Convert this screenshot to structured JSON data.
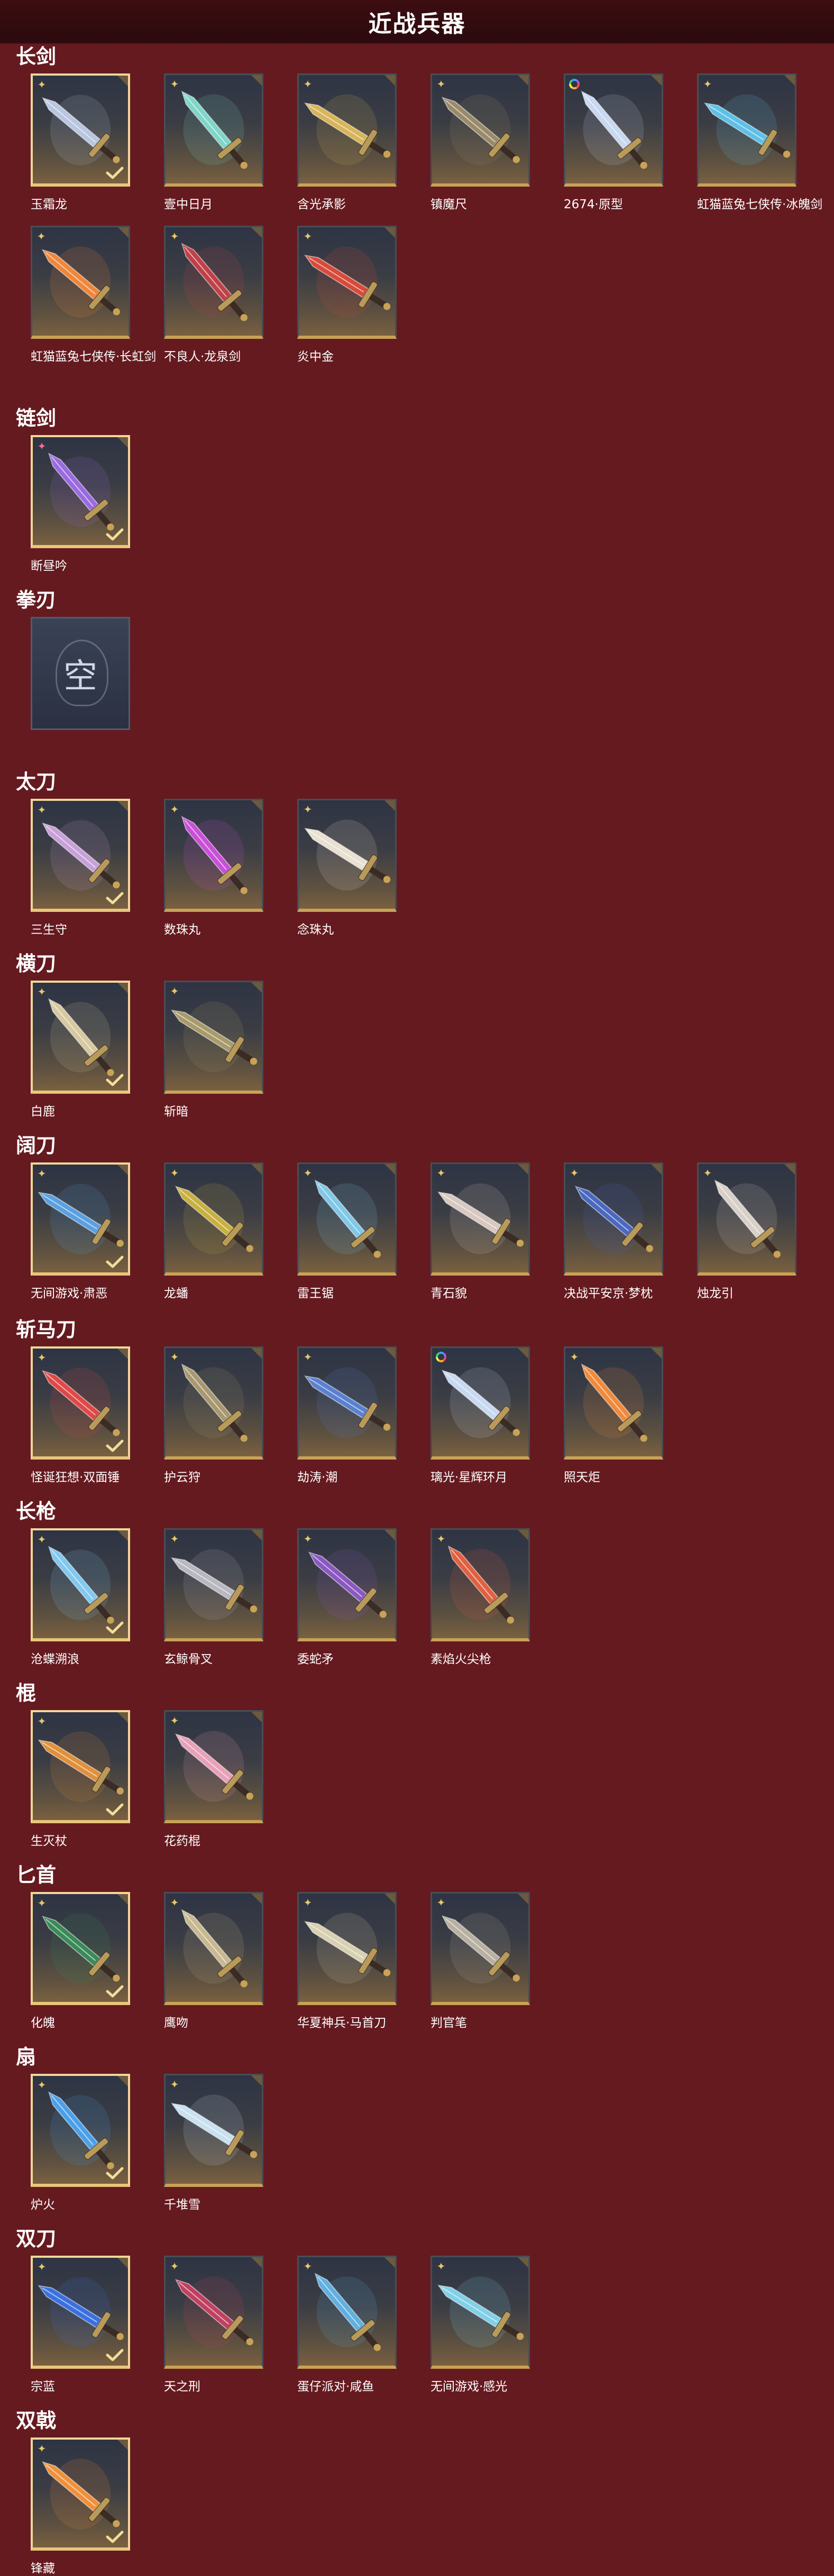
{
  "header": {
    "title": "近战兵器"
  },
  "categories": [
    {
      "name": "长剑",
      "items": [
        {
          "label": "玉霜龙",
          "selected": true,
          "rarity": "star",
          "color": "#b8c6e0"
        },
        {
          "label": "壹中日月",
          "selected": false,
          "rarity": "star",
          "color": "#7fd6c8"
        },
        {
          "label": "含光承影",
          "selected": false,
          "rarity": "star",
          "color": "#d8b45a"
        },
        {
          "label": "镇魔尺",
          "selected": false,
          "rarity": "star",
          "color": "#9a8a6a"
        },
        {
          "label": "2674·原型",
          "selected": false,
          "rarity": "rainbow",
          "color": "#c8d8f0"
        },
        {
          "label": "虹猫蓝兔七侠传·冰魄剑",
          "selected": false,
          "rarity": "star",
          "color": "#5ec0e8"
        },
        {
          "label": "虹猫蓝兔七侠传·长虹剑",
          "selected": false,
          "rarity": "star",
          "color": "#f0863a"
        },
        {
          "label": "不良人·龙泉剑",
          "selected": false,
          "rarity": "star",
          "color": "#c04048"
        },
        {
          "label": "炎中金",
          "selected": false,
          "rarity": "star",
          "color": "#d84a3a"
        }
      ]
    },
    {
      "name": "链剑",
      "items": [
        {
          "label": "断昼吟",
          "selected": true,
          "rarity": "pink",
          "color": "#9a6ae0"
        }
      ]
    },
    {
      "name": "拳刃",
      "items": [
        {
          "label": "",
          "selected": false,
          "rarity": "none",
          "empty": true,
          "empty_text": "空"
        }
      ]
    },
    {
      "name": "太刀",
      "items": [
        {
          "label": "三生守",
          "selected": true,
          "rarity": "star",
          "color": "#c8a0d8"
        },
        {
          "label": "数珠丸",
          "selected": false,
          "rarity": "star",
          "color": "#c850d8"
        },
        {
          "label": "念珠丸",
          "selected": false,
          "rarity": "star",
          "color": "#e8e0d0"
        }
      ]
    },
    {
      "name": "横刀",
      "items": [
        {
          "label": "白鹿",
          "selected": true,
          "rarity": "star",
          "color": "#d8c8a0"
        },
        {
          "label": "斩暗",
          "selected": false,
          "rarity": "star",
          "color": "#a89a6a"
        }
      ]
    },
    {
      "name": "阔刀",
      "items": [
        {
          "label": "无间游戏·肃恶",
          "selected": true,
          "rarity": "star",
          "color": "#5aa0e0"
        },
        {
          "label": "龙蟠",
          "selected": false,
          "rarity": "star",
          "color": "#c8b040"
        },
        {
          "label": "雷王锯",
          "selected": false,
          "rarity": "star",
          "color": "#80c8e8"
        },
        {
          "label": "青石貌",
          "selected": false,
          "rarity": "star",
          "color": "#d8c8c0"
        },
        {
          "label": "决战平安京·梦枕",
          "selected": false,
          "rarity": "star",
          "color": "#4a68c0"
        },
        {
          "label": "烛龙引",
          "selected": false,
          "rarity": "star",
          "color": "#d8d0c8"
        }
      ]
    },
    {
      "name": "斩马刀",
      "items": [
        {
          "label": "怪诞狂想·双面锤",
          "selected": true,
          "rarity": "star",
          "color": "#e04848"
        },
        {
          "label": "护云狩",
          "selected": false,
          "rarity": "star",
          "color": "#a89870"
        },
        {
          "label": "劫涛·潮",
          "selected": false,
          "rarity": "star",
          "color": "#5a80d0"
        },
        {
          "label": "璃光·星辉环月",
          "selected": false,
          "rarity": "rainbow",
          "color": "#c8d8f0"
        },
        {
          "label": "照天炬",
          "selected": false,
          "rarity": "star",
          "color": "#f08a3a"
        }
      ]
    },
    {
      "name": "长枪",
      "items": [
        {
          "label": "沧蝶溯浪",
          "selected": true,
          "rarity": "star",
          "color": "#80c8f0"
        },
        {
          "label": "玄鲸骨叉",
          "selected": false,
          "rarity": "star",
          "color": "#b8b8c0"
        },
        {
          "label": "委蛇矛",
          "selected": false,
          "rarity": "star",
          "color": "#8a58c0"
        },
        {
          "label": "素焰火尖枪",
          "selected": false,
          "rarity": "star",
          "color": "#e06040"
        }
      ]
    },
    {
      "name": "棍",
      "items": [
        {
          "label": "生灭杖",
          "selected": true,
          "rarity": "star",
          "color": "#e0903a"
        },
        {
          "label": "花药棍",
          "selected": false,
          "rarity": "star",
          "color": "#e8a0b8"
        }
      ]
    },
    {
      "name": "匕首",
      "items": [
        {
          "label": "化魄",
          "selected": true,
          "rarity": "star",
          "color": "#3a8a58"
        },
        {
          "label": "鹰吻",
          "selected": false,
          "rarity": "star",
          "color": "#c8b890"
        },
        {
          "label": "华夏神兵·马首刀",
          "selected": false,
          "rarity": "star",
          "color": "#d8d0b0"
        },
        {
          "label": "判官笔",
          "selected": false,
          "rarity": "star",
          "color": "#b8b0a0"
        }
      ]
    },
    {
      "name": "扇",
      "items": [
        {
          "label": "炉火",
          "selected": true,
          "rarity": "star",
          "color": "#4aa0e8"
        },
        {
          "label": "千堆雪",
          "selected": false,
          "rarity": "star",
          "color": "#c8e0f0"
        }
      ]
    },
    {
      "name": "双刀",
      "items": [
        {
          "label": "宗蓝",
          "selected": true,
          "rarity": "star",
          "color": "#3a70e0"
        },
        {
          "label": "天之刑",
          "selected": false,
          "rarity": "star",
          "color": "#c04060"
        },
        {
          "label": "蛋仔派对·咸鱼",
          "selected": false,
          "rarity": "star",
          "color": "#60b0e0"
        },
        {
          "label": "无间游戏·感光",
          "selected": false,
          "rarity": "star",
          "color": "#80d0e8"
        }
      ]
    },
    {
      "name": "双戟",
      "items": [
        {
          "label": "锋藏",
          "selected": true,
          "rarity": "star",
          "color": "#f0903a"
        }
      ]
    }
  ]
}
